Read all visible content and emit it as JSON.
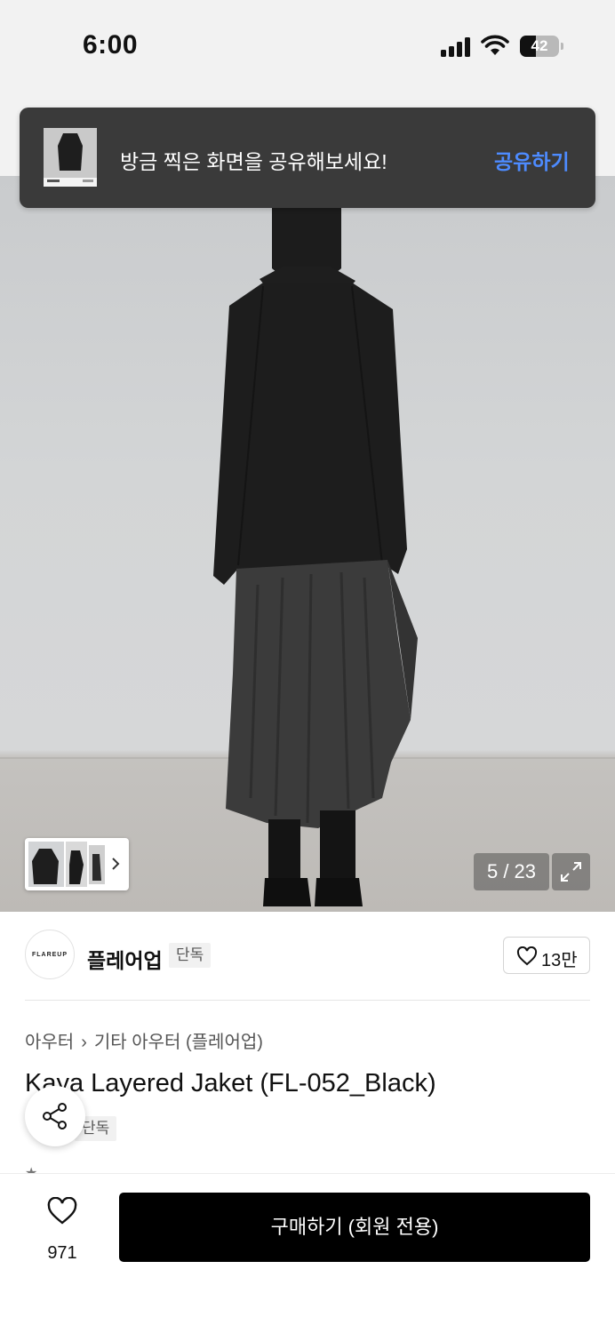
{
  "status_bar": {
    "time": "6:00",
    "battery": "42",
    "battery_level": 0.42
  },
  "toast": {
    "message": "방금 찍은 화면을 공유해보세요!",
    "action": "공유하기"
  },
  "gallery": {
    "counter": "5 / 23"
  },
  "brand": {
    "logo_text": "FLAREUP",
    "name": "플레어업",
    "badge": "단독",
    "likes": "13만"
  },
  "breadcrumb": {
    "category": "아우터",
    "subcategory": "기타 아우터 (플레어업)"
  },
  "product": {
    "title": "Kaya Layered Jaket (FL-052_Black)",
    "badge": "단독"
  },
  "bottom_bar": {
    "like_count": "971",
    "buy_label": "구매하기 (회원 전용)"
  },
  "colors": {
    "accent": "#4d8bff",
    "toast_bg": "#3a3a3a",
    "buy_bg": "#000000"
  }
}
